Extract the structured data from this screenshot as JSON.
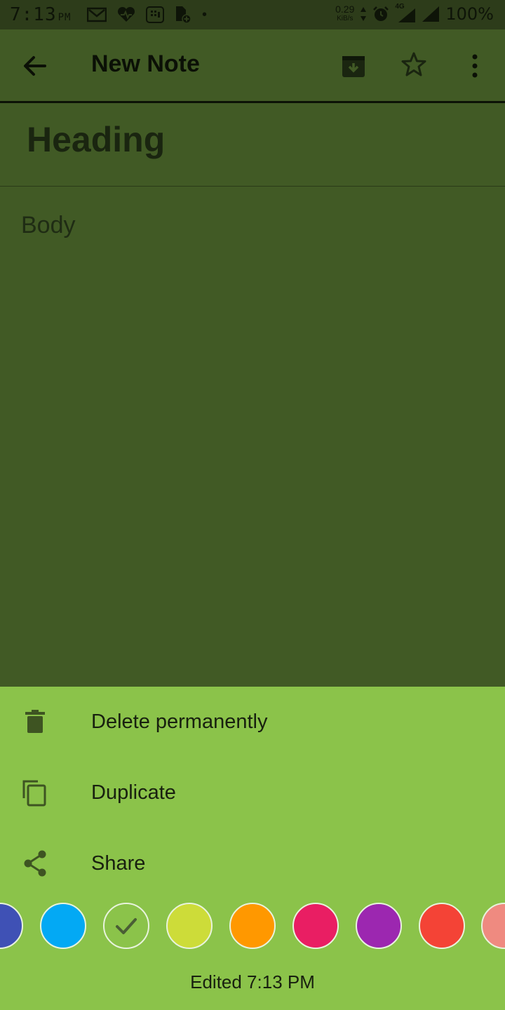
{
  "status_bar": {
    "time": "7:13",
    "ampm": "PM",
    "net_speed": "0.29",
    "net_unit": "KiB/s",
    "network": "4G",
    "battery": "100%"
  },
  "appbar": {
    "title": "New Note",
    "icons": [
      "back-arrow-icon",
      "archive-icon",
      "star-icon",
      "more-vert-icon"
    ]
  },
  "note": {
    "heading_placeholder": "Heading",
    "body_placeholder": "Body"
  },
  "menu": {
    "items": [
      {
        "label": "Delete permanently",
        "icon": "trash-icon"
      },
      {
        "label": "Duplicate",
        "icon": "copy-icon"
      },
      {
        "label": "Share",
        "icon": "share-icon"
      }
    ]
  },
  "colors": {
    "background_dim": "#415a25",
    "sheet": "#8bc34a",
    "swatches": [
      "#3f51b5",
      "#03a9f4",
      "#8bc34a",
      "#cddc39",
      "#ff9800",
      "#e91e63",
      "#9c27b0",
      "#f44336",
      "#ef8a80"
    ],
    "selected_swatch": "#8bc34a"
  },
  "footer": {
    "edited": "Edited 7:13 PM"
  }
}
